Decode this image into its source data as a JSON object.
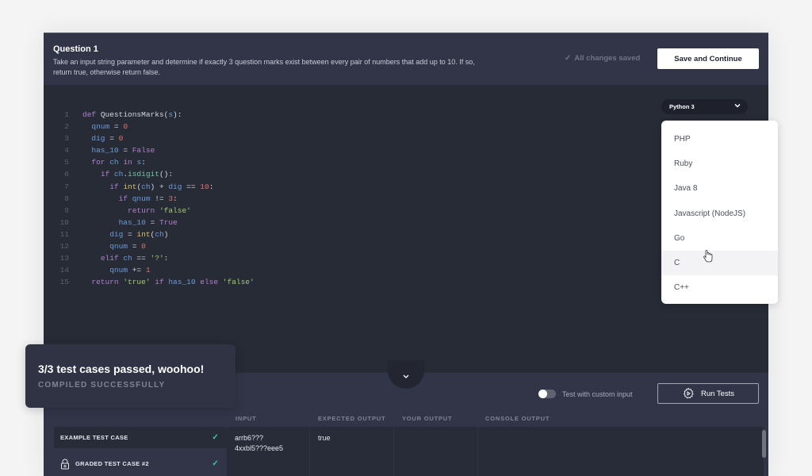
{
  "question": {
    "title": "Question 1",
    "description": "Take an input string parameter and determine if exactly 3 question marks exist between every pair of numbers that add up to 10. If so, return true, otherwise return false."
  },
  "header": {
    "saved_status": "All changes saved",
    "save_label": "Save and Continue"
  },
  "editor": {
    "language": "Python 3",
    "lines": [
      {
        "n": "1",
        "indent": 0,
        "tokens": [
          [
            "kw",
            "def "
          ],
          [
            "fn",
            "QuestionsMarks("
          ],
          [
            "var",
            "s"
          ],
          [
            "fn",
            "):"
          ]
        ]
      },
      {
        "n": "2",
        "indent": 1,
        "tokens": [
          [
            "var",
            "qnum"
          ],
          [
            "op",
            " = "
          ],
          [
            "num",
            "0"
          ]
        ]
      },
      {
        "n": "3",
        "indent": 1,
        "tokens": [
          [
            "var",
            "dig"
          ],
          [
            "op",
            " = "
          ],
          [
            "num",
            "0"
          ]
        ]
      },
      {
        "n": "4",
        "indent": 1,
        "tokens": [
          [
            "var",
            "has_10"
          ],
          [
            "op",
            " = "
          ],
          [
            "kw",
            "False"
          ]
        ]
      },
      {
        "n": "5",
        "indent": 1,
        "tokens": [
          [
            "kw",
            "for "
          ],
          [
            "var",
            "ch"
          ],
          [
            "kw",
            " in "
          ],
          [
            "var",
            "s"
          ],
          [
            "op",
            ":"
          ]
        ]
      },
      {
        "n": "6",
        "indent": 2,
        "tokens": [
          [
            "kw",
            "if "
          ],
          [
            "var",
            "ch"
          ],
          [
            "op",
            "."
          ],
          [
            "meth",
            "isdigit"
          ],
          [
            "op",
            "():"
          ]
        ]
      },
      {
        "n": "7",
        "indent": 3,
        "tokens": [
          [
            "kw",
            "if "
          ],
          [
            "bi",
            "int"
          ],
          [
            "op",
            "("
          ],
          [
            "var",
            "ch"
          ],
          [
            "op",
            ") + "
          ],
          [
            "var",
            "dig"
          ],
          [
            "op",
            " == "
          ],
          [
            "num",
            "10"
          ],
          [
            "op",
            ":"
          ]
        ]
      },
      {
        "n": "8",
        "indent": 4,
        "tokens": [
          [
            "kw",
            "if "
          ],
          [
            "var",
            "qnum"
          ],
          [
            "op",
            " != "
          ],
          [
            "num",
            "3"
          ],
          [
            "op",
            ":"
          ]
        ]
      },
      {
        "n": "9",
        "indent": 5,
        "tokens": [
          [
            "kw",
            "return "
          ],
          [
            "str",
            "'false'"
          ]
        ]
      },
      {
        "n": "10",
        "indent": 4,
        "tokens": [
          [
            "var",
            "has_10"
          ],
          [
            "op",
            " = "
          ],
          [
            "kw",
            "True"
          ]
        ]
      },
      {
        "n": "11",
        "indent": 3,
        "tokens": [
          [
            "var",
            "dig"
          ],
          [
            "op",
            " = "
          ],
          [
            "bi",
            "int"
          ],
          [
            "op",
            "("
          ],
          [
            "var",
            "ch"
          ],
          [
            "op",
            ")"
          ]
        ]
      },
      {
        "n": "12",
        "indent": 3,
        "tokens": [
          [
            "var",
            "qnum"
          ],
          [
            "op",
            " = "
          ],
          [
            "num",
            "0"
          ]
        ]
      },
      {
        "n": "13",
        "indent": 2,
        "tokens": [
          [
            "kw",
            "elif "
          ],
          [
            "var",
            "ch"
          ],
          [
            "op",
            " == "
          ],
          [
            "str",
            "'?'"
          ],
          [
            "op",
            ":"
          ]
        ]
      },
      {
        "n": "14",
        "indent": 3,
        "tokens": [
          [
            "var",
            "qnum"
          ],
          [
            "op",
            " += "
          ],
          [
            "num",
            "1"
          ]
        ]
      },
      {
        "n": "15",
        "indent": 1,
        "tokens": [
          [
            "kw",
            "return "
          ],
          [
            "str",
            "'true'"
          ],
          [
            "kw",
            " if "
          ],
          [
            "var",
            "has_10"
          ],
          [
            "kw",
            " else "
          ],
          [
            "str",
            "'false'"
          ]
        ]
      }
    ]
  },
  "language_dropdown": {
    "options": [
      "PHP",
      "Ruby",
      "Java 8",
      "Javascript (NodeJS)",
      "Go",
      "C",
      "C++"
    ],
    "hovered": "C"
  },
  "tests": {
    "custom_input_label": "Test with custom input",
    "custom_input_enabled": false,
    "run_label": "Run Tests",
    "columns": [
      "INPUT",
      "EXPECTED OUTPUT",
      "YOUR OUTPUT",
      "CONSOLE OUTPUT"
    ],
    "cases": [
      {
        "label": "EXAMPLE TEST CASE",
        "locked": false,
        "passed": true
      },
      {
        "label": "GRADED TEST CASE #2",
        "locked": true,
        "passed": true
      }
    ],
    "selected": {
      "input": "arrb6???\n4xxbl5???eee5",
      "expected": "true",
      "your_output": "",
      "console_output": ""
    }
  },
  "toast": {
    "title": "3/3 test cases passed, woohoo!",
    "subtitle": "COMPILED SUCCESSFULLY"
  }
}
